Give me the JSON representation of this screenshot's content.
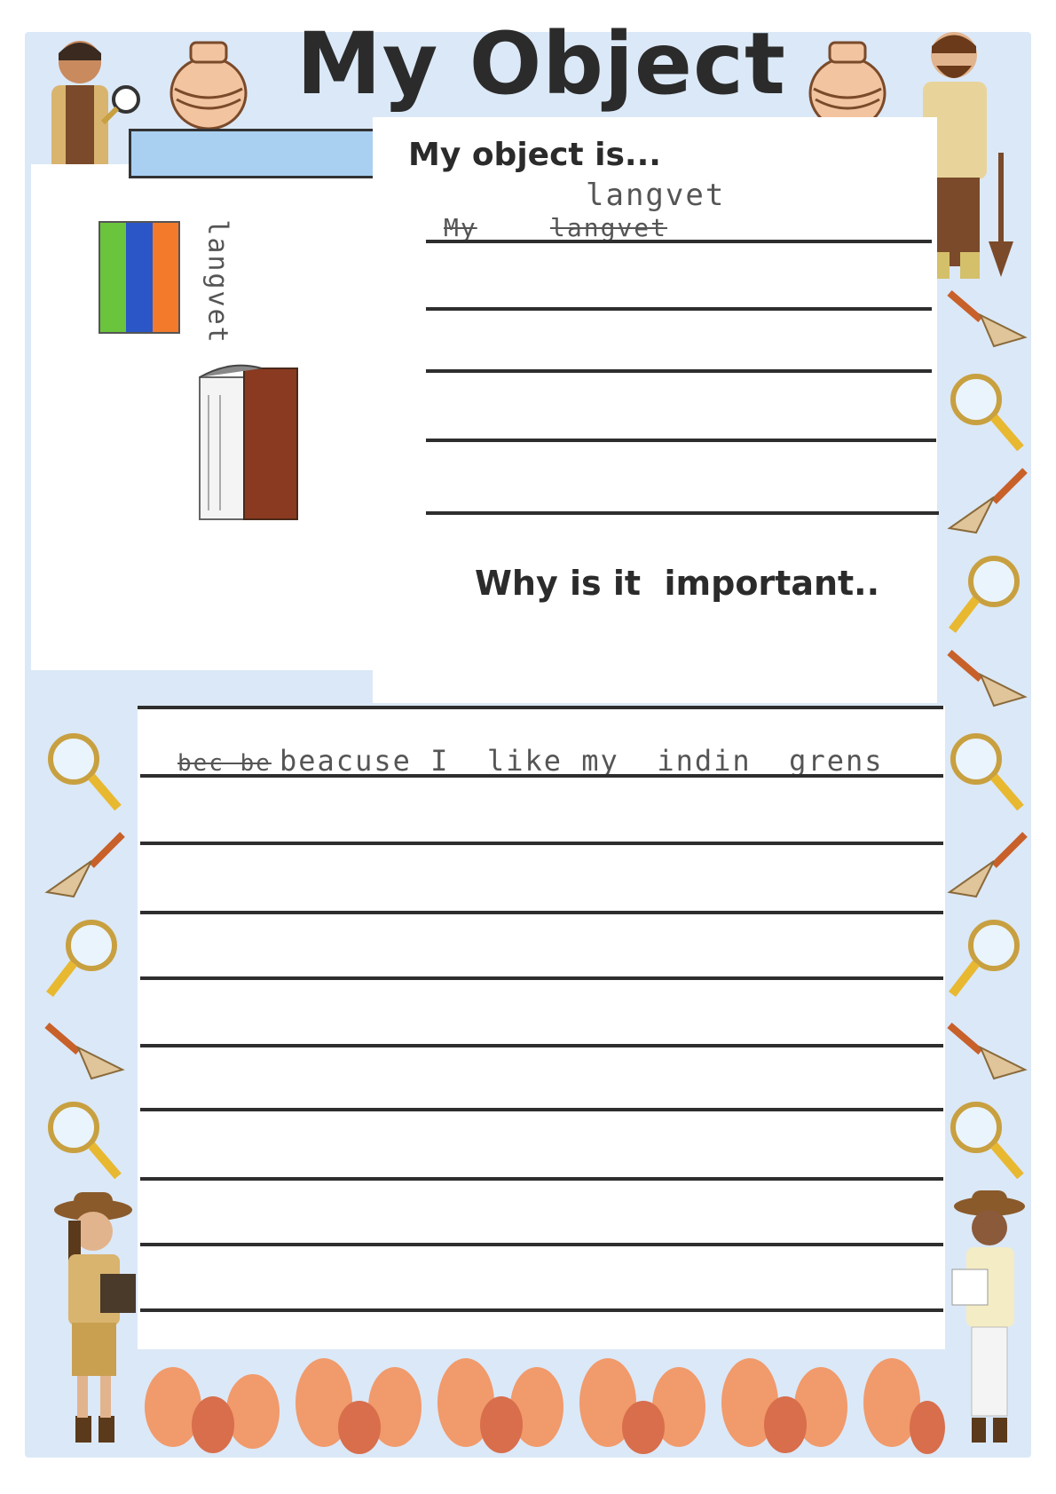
{
  "title": "My Object",
  "section1": {
    "heading": "My object is...",
    "answer_crossed_1": "My",
    "answer_crossed_2": "langvet",
    "answer_correction": "langvet"
  },
  "drawing": {
    "vertical_label": "langvet"
  },
  "section2": {
    "heading": "Why is it  important..",
    "answer_crossed": "bec be",
    "answer": "beacuse I  like my  indin  grens"
  },
  "colors": {
    "frame_blue": "#dbe8f7",
    "pot_orange": "#f19a6b",
    "pot_dark": "#d86e4c",
    "rule": "#2e2e2e"
  }
}
